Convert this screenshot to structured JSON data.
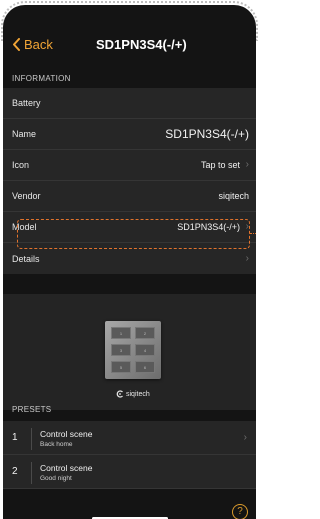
{
  "nav": {
    "back_label": "Back",
    "title": "SD1PN3S4(-/+)"
  },
  "information": {
    "header": "INFORMATION",
    "battery_label": "Battery",
    "name_label": "Name",
    "name_value": "SD1PN3S4(-/+)",
    "icon_label": "Icon",
    "icon_value": "Tap to set",
    "vendor_label": "Vendor",
    "vendor_value": "siqitech",
    "model_label": "Model",
    "model_value": "SD1PN3S4(-/+)",
    "details_label": "Details"
  },
  "device_image": {
    "brand": "siqitech",
    "keys": [
      "1",
      "2",
      "3",
      "4",
      "5",
      "6"
    ]
  },
  "presets": {
    "header": "PRESETS",
    "items": [
      {
        "num": "1",
        "name": "Control scene",
        "sub": "Back home"
      },
      {
        "num": "2",
        "name": "Control scene",
        "sub": "Good night"
      }
    ]
  },
  "icons": {
    "back": "chevron-left-icon",
    "chevron": "chevron-right-icon",
    "help": "question-mark-icon",
    "brand_logo": "siqitech-logo-icon"
  },
  "colors": {
    "accent": "#f0a436",
    "background": "#141414",
    "cell": "#262626",
    "highlight_outline": "#e2732c"
  }
}
